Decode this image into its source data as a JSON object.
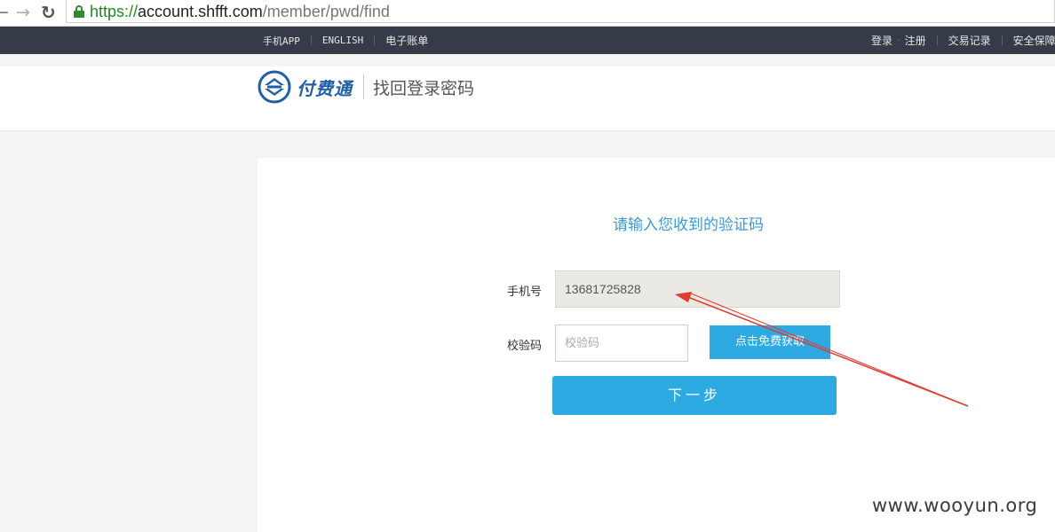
{
  "browser": {
    "url_scheme": "https://",
    "url_host": "account.shfft.com",
    "url_path": "/member/pwd/find"
  },
  "topnav": {
    "left_links": [
      "手机APP",
      "ENGLISH",
      "电子账单"
    ],
    "right_links": [
      "登录",
      "注册",
      "交易记录",
      "安全保障"
    ]
  },
  "header": {
    "logo_text": "付费通",
    "page_title": "找回登录密码"
  },
  "form": {
    "title": "请输入您收到的验证码",
    "phone_label": "手机号",
    "phone_value": "13681725828",
    "code_label": "校验码",
    "code_placeholder": "校验码",
    "get_code_button": "点击免费获取",
    "next_button": "下一步"
  },
  "watermark": "www.wooyun.org",
  "colors": {
    "accent": "#2eaae3",
    "topnav_bg": "#353c48",
    "annotation_arrow": "#e23a2e",
    "logo_blue": "#1e5fa8"
  }
}
